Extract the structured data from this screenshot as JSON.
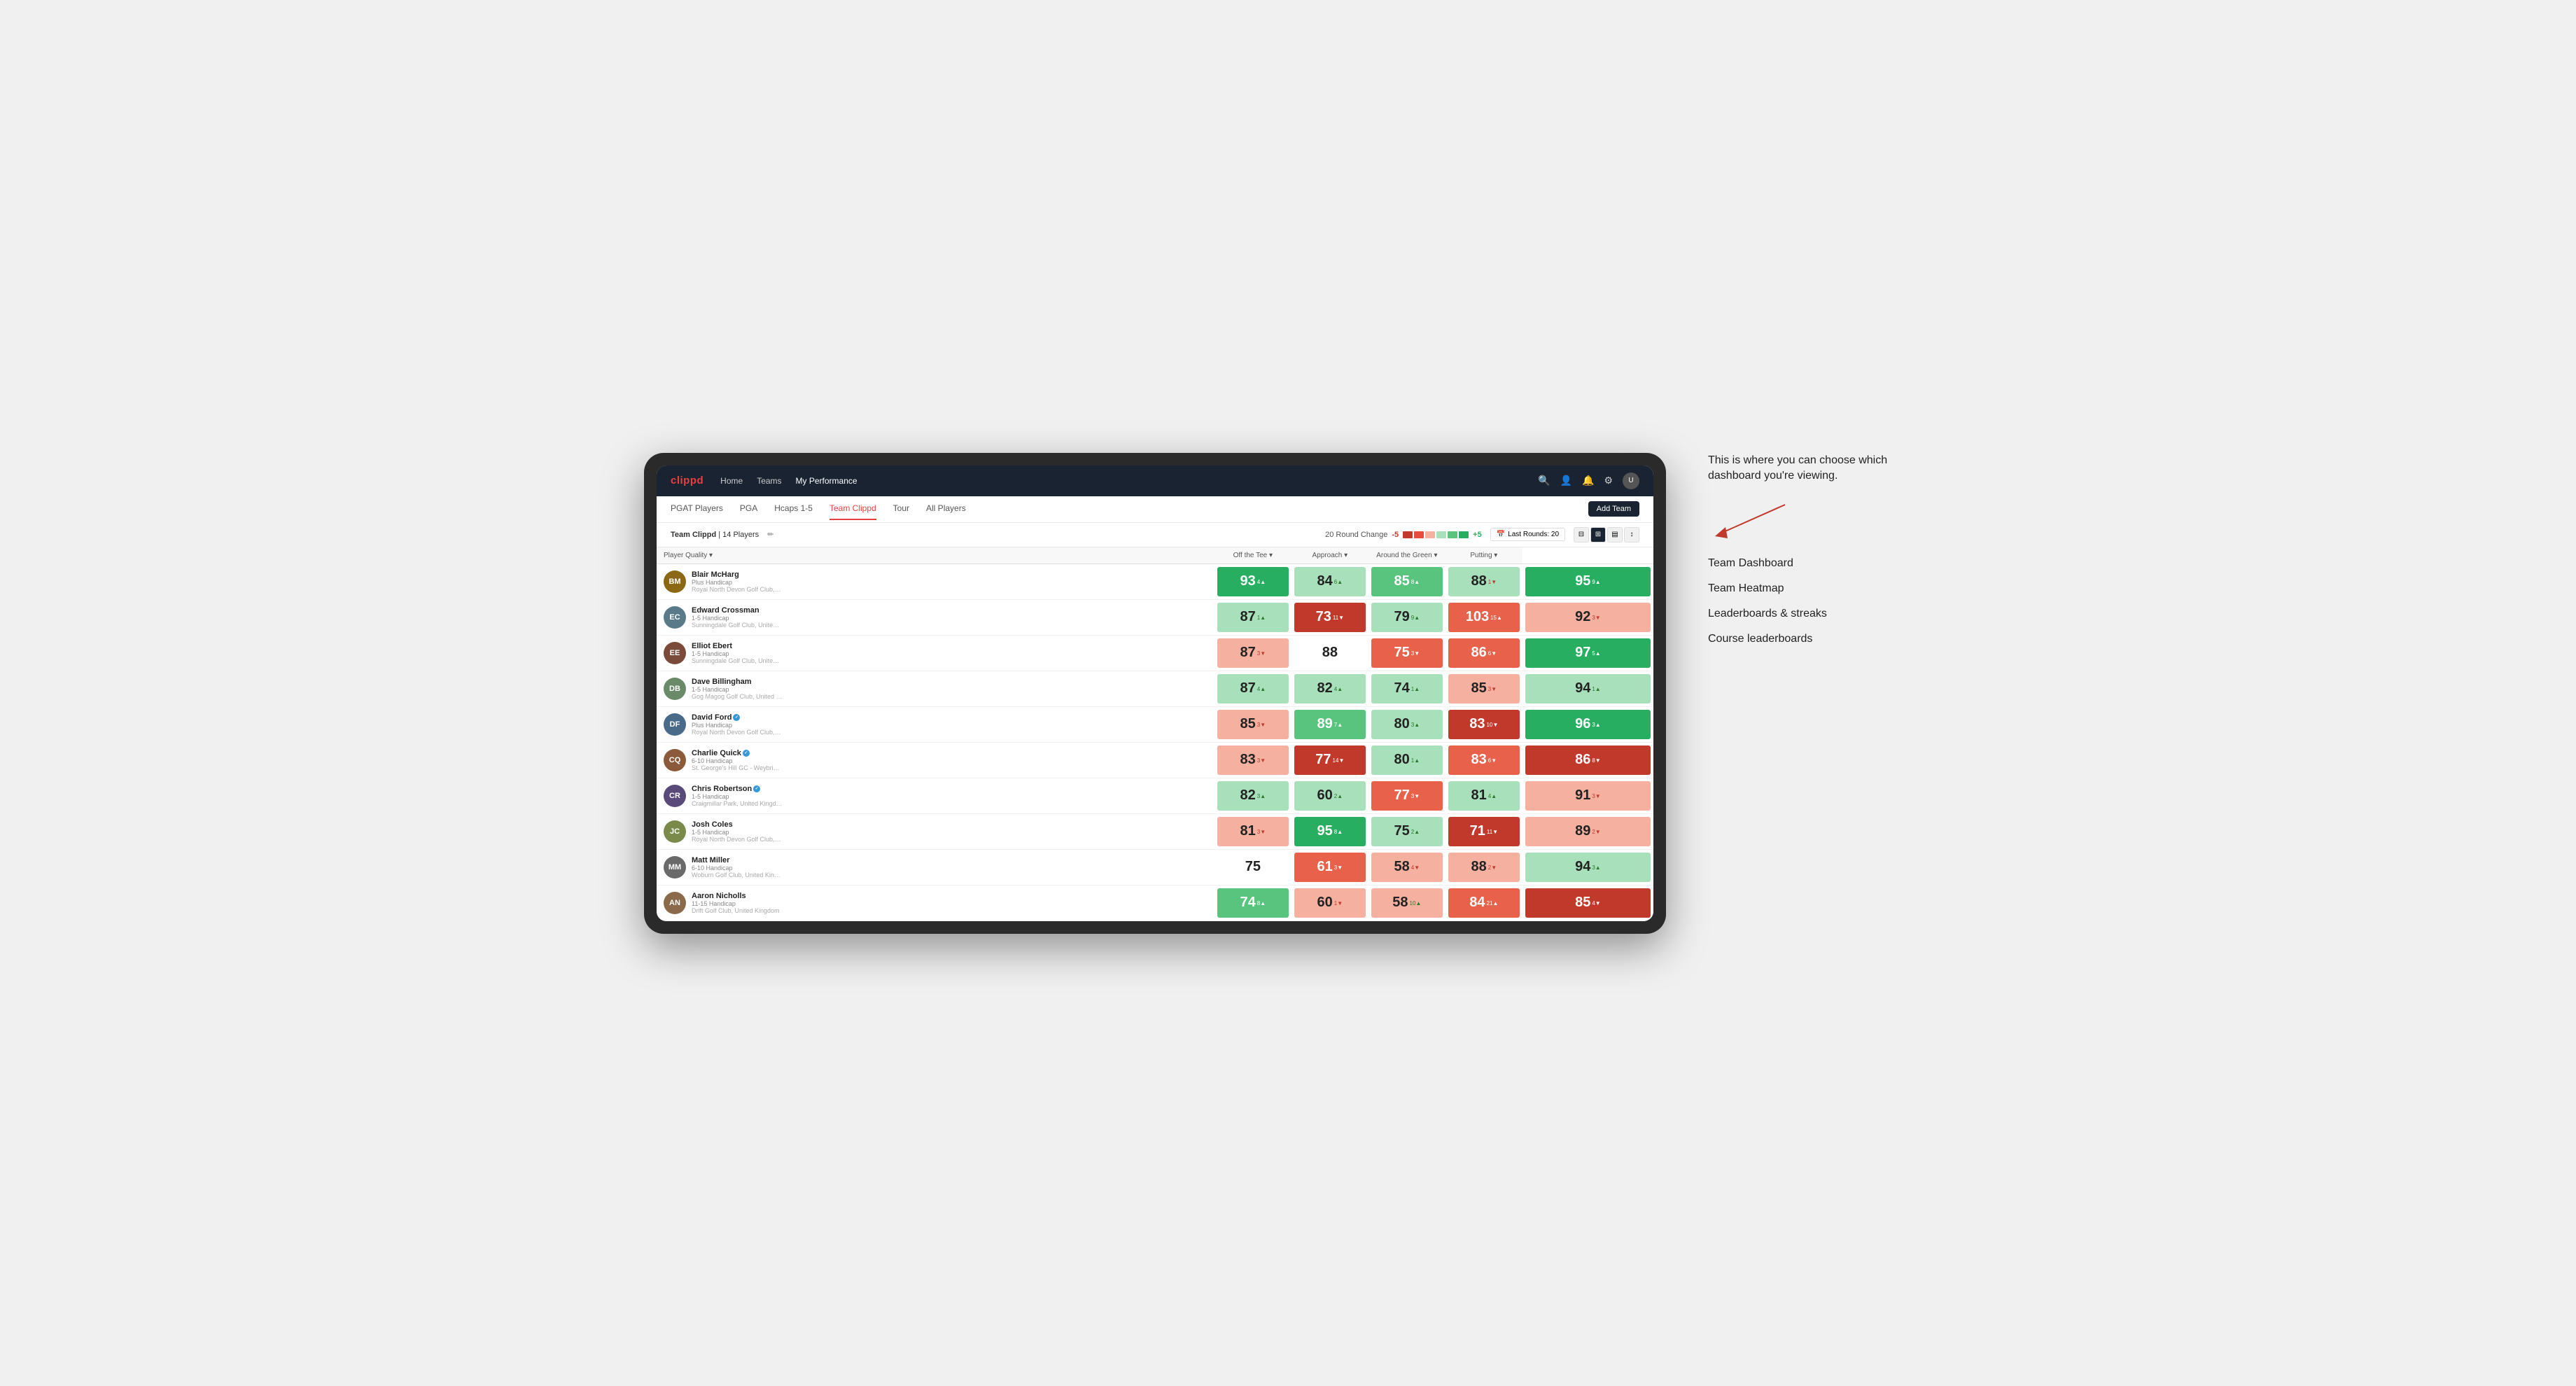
{
  "annotation": {
    "intro": "This is where you can choose which dashboard you're viewing.",
    "items": [
      "Team Dashboard",
      "Team Heatmap",
      "Leaderboards & streaks",
      "Course leaderboards"
    ]
  },
  "nav": {
    "logo": "clippd",
    "links": [
      "Home",
      "Teams",
      "My Performance"
    ],
    "active_link": "My Performance"
  },
  "sub_nav": {
    "links": [
      "PGAT Players",
      "PGA",
      "Hcaps 1-5",
      "Team Clippd",
      "Tour",
      "All Players"
    ],
    "active": "Team Clippd",
    "add_team_label": "Add Team"
  },
  "toolbar": {
    "team_label": "Team Clippd",
    "player_count": "14 Players",
    "round_change_label": "20 Round Change",
    "change_value": "-5",
    "change_pos": "+5",
    "last_rounds_label": "Last Rounds:",
    "last_rounds_value": "20"
  },
  "table": {
    "headers": [
      "Player Quality ▾",
      "Off the Tee ▾",
      "Approach ▾",
      "Around the Green ▾",
      "Putting ▾"
    ],
    "players": [
      {
        "name": "Blair McHarg",
        "handicap": "Plus Handicap",
        "club": "Royal North Devon Golf Club, United Kingdom",
        "initials": "BM",
        "color": "#8B6914",
        "scores": [
          {
            "value": 93,
            "change": 4,
            "dir": "up",
            "bg": "bg-green-dark"
          },
          {
            "value": 84,
            "change": 6,
            "dir": "up",
            "bg": "bg-green-light"
          },
          {
            "value": 85,
            "change": 8,
            "dir": "up",
            "bg": "bg-green-med"
          },
          {
            "value": 88,
            "change": 1,
            "dir": "down",
            "bg": "bg-green-light"
          },
          {
            "value": 95,
            "change": 9,
            "dir": "up",
            "bg": "bg-green-dark"
          }
        ]
      },
      {
        "name": "Edward Crossman",
        "handicap": "1-5 Handicap",
        "club": "Sunningdale Golf Club, United Kingdom",
        "initials": "EC",
        "color": "#5a7a8a",
        "scores": [
          {
            "value": 87,
            "change": 1,
            "dir": "up",
            "bg": "bg-green-light"
          },
          {
            "value": 73,
            "change": 11,
            "dir": "down",
            "bg": "bg-red-dark"
          },
          {
            "value": 79,
            "change": 9,
            "dir": "up",
            "bg": "bg-green-light"
          },
          {
            "value": 103,
            "change": 15,
            "dir": "up",
            "bg": "bg-red-med"
          },
          {
            "value": 92,
            "change": 3,
            "dir": "down",
            "bg": "bg-red-light"
          }
        ]
      },
      {
        "name": "Elliot Ebert",
        "handicap": "1-5 Handicap",
        "club": "Sunningdale Golf Club, United Kingdom",
        "initials": "EE",
        "color": "#7a4a3a",
        "scores": [
          {
            "value": 87,
            "change": 3,
            "dir": "down",
            "bg": "bg-red-light"
          },
          {
            "value": 88,
            "change": null,
            "dir": "neutral",
            "bg": "bg-white"
          },
          {
            "value": 75,
            "change": 3,
            "dir": "down",
            "bg": "bg-red-med"
          },
          {
            "value": 86,
            "change": 6,
            "dir": "down",
            "bg": "bg-red-med"
          },
          {
            "value": 97,
            "change": 5,
            "dir": "up",
            "bg": "bg-green-dark"
          }
        ]
      },
      {
        "name": "Dave Billingham",
        "handicap": "1-5 Handicap",
        "club": "Gog Magog Golf Club, United Kingdom",
        "initials": "DB",
        "color": "#6a8a6a",
        "scores": [
          {
            "value": 87,
            "change": 4,
            "dir": "up",
            "bg": "bg-green-light"
          },
          {
            "value": 82,
            "change": 4,
            "dir": "up",
            "bg": "bg-green-light"
          },
          {
            "value": 74,
            "change": 1,
            "dir": "up",
            "bg": "bg-green-light"
          },
          {
            "value": 85,
            "change": 3,
            "dir": "down",
            "bg": "bg-red-light"
          },
          {
            "value": 94,
            "change": 1,
            "dir": "up",
            "bg": "bg-green-light"
          }
        ]
      },
      {
        "name": "David Ford",
        "handicap": "Plus Handicap",
        "club": "Royal North Devon Golf Club, United Kingdom",
        "initials": "DF",
        "color": "#4a6a8a",
        "verified": true,
        "scores": [
          {
            "value": 85,
            "change": 3,
            "dir": "down",
            "bg": "bg-red-light"
          },
          {
            "value": 89,
            "change": 7,
            "dir": "up",
            "bg": "bg-green-med"
          },
          {
            "value": 80,
            "change": 3,
            "dir": "up",
            "bg": "bg-green-light"
          },
          {
            "value": 83,
            "change": 10,
            "dir": "down",
            "bg": "bg-red-dark"
          },
          {
            "value": 96,
            "change": 3,
            "dir": "up",
            "bg": "bg-green-dark"
          }
        ]
      },
      {
        "name": "Charlie Quick",
        "handicap": "6-10 Handicap",
        "club": "St. George's Hill GC - Weybridge - Surrey, Uni...",
        "initials": "CQ",
        "color": "#8a5a3a",
        "verified": true,
        "scores": [
          {
            "value": 83,
            "change": 3,
            "dir": "down",
            "bg": "bg-red-light"
          },
          {
            "value": 77,
            "change": 14,
            "dir": "down",
            "bg": "bg-red-dark"
          },
          {
            "value": 80,
            "change": 1,
            "dir": "up",
            "bg": "bg-green-light"
          },
          {
            "value": 83,
            "change": 6,
            "dir": "down",
            "bg": "bg-red-med"
          },
          {
            "value": 86,
            "change": 8,
            "dir": "down",
            "bg": "bg-red-dark"
          }
        ]
      },
      {
        "name": "Chris Robertson",
        "handicap": "1-5 Handicap",
        "club": "Craigmillar Park, United Kingdom",
        "initials": "CR",
        "color": "#5a4a7a",
        "verified": true,
        "scores": [
          {
            "value": 82,
            "change": 3,
            "dir": "up",
            "bg": "bg-green-light"
          },
          {
            "value": 60,
            "change": 2,
            "dir": "up",
            "bg": "bg-green-light"
          },
          {
            "value": 77,
            "change": 3,
            "dir": "down",
            "bg": "bg-red-med"
          },
          {
            "value": 81,
            "change": 4,
            "dir": "up",
            "bg": "bg-green-light"
          },
          {
            "value": 91,
            "change": 3,
            "dir": "down",
            "bg": "bg-red-light"
          }
        ]
      },
      {
        "name": "Josh Coles",
        "handicap": "1-5 Handicap",
        "club": "Royal North Devon Golf Club, United Kingdom",
        "initials": "JC",
        "color": "#7a8a4a",
        "scores": [
          {
            "value": 81,
            "change": 3,
            "dir": "down",
            "bg": "bg-red-light"
          },
          {
            "value": 95,
            "change": 8,
            "dir": "up",
            "bg": "bg-green-dark"
          },
          {
            "value": 75,
            "change": 2,
            "dir": "up",
            "bg": "bg-green-light"
          },
          {
            "value": 71,
            "change": 11,
            "dir": "down",
            "bg": "bg-red-dark"
          },
          {
            "value": 89,
            "change": 2,
            "dir": "down",
            "bg": "bg-red-light"
          }
        ]
      },
      {
        "name": "Matt Miller",
        "handicap": "6-10 Handicap",
        "club": "Woburn Golf Club, United Kingdom",
        "initials": "MM",
        "color": "#6a6a6a",
        "scores": [
          {
            "value": 75,
            "change": null,
            "dir": "neutral",
            "bg": "bg-white"
          },
          {
            "value": 61,
            "change": 3,
            "dir": "down",
            "bg": "bg-red-med"
          },
          {
            "value": 58,
            "change": 4,
            "dir": "down",
            "bg": "bg-red-light"
          },
          {
            "value": 88,
            "change": 2,
            "dir": "down",
            "bg": "bg-red-light"
          },
          {
            "value": 94,
            "change": 3,
            "dir": "up",
            "bg": "bg-green-light"
          }
        ]
      },
      {
        "name": "Aaron Nicholls",
        "handicap": "11-15 Handicap",
        "club": "Drift Golf Club, United Kingdom",
        "initials": "AN",
        "color": "#8a6a4a",
        "scores": [
          {
            "value": 74,
            "change": 8,
            "dir": "up",
            "bg": "bg-green-med"
          },
          {
            "value": 60,
            "change": 1,
            "dir": "down",
            "bg": "bg-red-light"
          },
          {
            "value": 58,
            "change": 10,
            "dir": "up",
            "bg": "bg-red-light"
          },
          {
            "value": 84,
            "change": 21,
            "dir": "up",
            "bg": "bg-red-med"
          },
          {
            "value": 85,
            "change": 4,
            "dir": "down",
            "bg": "bg-red-dark"
          }
        ]
      }
    ]
  }
}
